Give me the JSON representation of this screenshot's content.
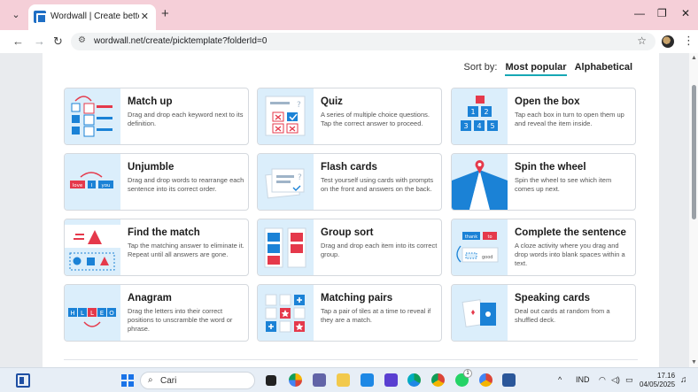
{
  "browser": {
    "tab_title": "Wordwall | Create better lesson",
    "url": "wordwall.net/create/picktemplate?folderId=0",
    "tab_menu_icon": "chevron-down-icon",
    "close_glyph": "✕",
    "new_tab_glyph": "+",
    "minimize_glyph": "—",
    "restore_glyph": "❐",
    "window_close_glyph": "✕",
    "back_glyph": "←",
    "forward_glyph": "→",
    "reload_glyph": "↻",
    "tune_glyph": "⚙",
    "star_glyph": "☆",
    "menu_glyph": "⋮"
  },
  "sort": {
    "label": "Sort by:",
    "active": "Most popular",
    "alternative": "Alphabetical"
  },
  "templates": [
    {
      "name": "Match up",
      "desc": "Drag and drop each keyword next to its definition."
    },
    {
      "name": "Quiz",
      "desc": "A series of multiple choice questions. Tap the correct answer to proceed."
    },
    {
      "name": "Open the box",
      "desc": "Tap each box in turn to open them up and reveal the item inside."
    },
    {
      "name": "Unjumble",
      "desc": "Drag and drop words to rearrange each sentence into its correct order."
    },
    {
      "name": "Flash cards",
      "desc": "Test yourself using cards with prompts on the front and answers on the back."
    },
    {
      "name": "Spin the wheel",
      "desc": "Spin the wheel to see which item comes up next."
    },
    {
      "name": "Find the match",
      "desc": "Tap the matching answer to eliminate it. Repeat until all answers are gone."
    },
    {
      "name": "Group sort",
      "desc": "Drag and drop each item into its correct group."
    },
    {
      "name": "Complete the sentence",
      "desc": "A cloze activity where you drag and drop words into blank spaces within a text."
    },
    {
      "name": "Anagram",
      "desc": "Drag the letters into their correct positions to unscramble the word or phrase."
    },
    {
      "name": "Matching pairs",
      "desc": "Tap a pair of tiles at a time to reveal if they are a match."
    },
    {
      "name": "Speaking cards",
      "desc": "Deal out cards at random from a shuffled deck."
    }
  ],
  "thumb_text": {
    "unjumble": [
      "love",
      "I",
      "you"
    ],
    "open_box": [
      "1",
      "2",
      "3",
      "4",
      "5"
    ],
    "anagram": [
      "H",
      "L",
      "L",
      "E",
      "O"
    ],
    "complete": [
      "thank",
      "to",
      "good"
    ]
  },
  "taskbar": {
    "search_placeholder": "Cari",
    "search_glyph": "⌕",
    "tray_chevron": "^",
    "language": "IND",
    "time": "17.16",
    "date": "04/05/2025",
    "whatsapp_badge": "1",
    "bell_glyph": "🔔"
  },
  "colors": {
    "accent": "#16a7b4",
    "thumb_bg": "#dbeefb",
    "tile_blue": "#1b82d6",
    "tile_red": "#e5394b",
    "tab_strip": "#f5cfd8"
  }
}
